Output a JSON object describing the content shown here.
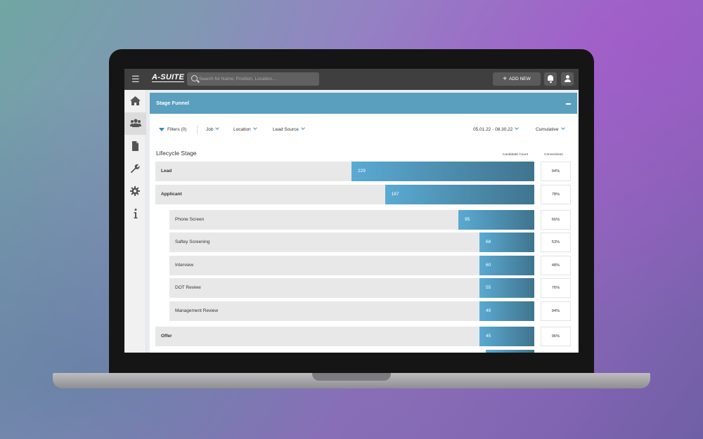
{
  "app": {
    "logo": "A-SUITE",
    "menu_icon": "hamburger-icon",
    "search_placeholder": "Search for Name, Position, Location....",
    "add_new_label": "ADD NEW",
    "icons": [
      "bell-icon",
      "user-icon"
    ]
  },
  "sidebar": {
    "items": [
      {
        "name": "home",
        "icon": "home-icon",
        "active": false
      },
      {
        "name": "candidates",
        "icon": "users-icon",
        "active": true
      },
      {
        "name": "documents",
        "icon": "document-icon",
        "active": false
      },
      {
        "name": "tools",
        "icon": "wrench-icon",
        "active": false
      },
      {
        "name": "settings",
        "icon": "gear-icon",
        "active": false
      },
      {
        "name": "info",
        "icon": "info-icon",
        "active": false
      }
    ]
  },
  "card": {
    "title": "Stage Funnel",
    "collapse_icon": "minus-icon"
  },
  "filters": {
    "filters_label": "Filters (0)",
    "job_label": "Job",
    "location_label": "Location",
    "lead_source_label": "Lead Source",
    "date_range": "05.01.22 - 08.30.22",
    "mode": "Cumulative"
  },
  "funnel": {
    "section_title": "Lifecycle Stage",
    "col_count_label": "Candidate Count",
    "col_conv_label": "Conversions",
    "max_count": 229,
    "stages": [
      {
        "label": "Lead",
        "count": 229,
        "count_text": "229",
        "conversion": "94%",
        "level": 0
      },
      {
        "label": "Applicant",
        "count": 187,
        "count_text": "187",
        "conversion": "78%",
        "level": 0
      },
      {
        "label": "Phone Screen",
        "count": 95,
        "count_text": "95",
        "conversion": "66%",
        "level": 1
      },
      {
        "label": "Saftey Screening",
        "count": 68,
        "count_text": "68",
        "conversion": "53%",
        "level": 1
      },
      {
        "label": "Interview",
        "count": 60,
        "count_text": "60",
        "conversion": "48%",
        "level": 1
      },
      {
        "label": "DOT Review",
        "count": 55,
        "count_text": "55",
        "conversion": "76%",
        "level": 1
      },
      {
        "label": "Management Review",
        "count": 49,
        "count_text": "49",
        "conversion": "94%",
        "level": 1
      },
      {
        "label": "Offer",
        "count": 45,
        "count_text": "45",
        "conversion": "96%",
        "level": 0
      }
    ]
  },
  "colors": {
    "accent": "#5b9fbe",
    "bar_start": "#5aaad3",
    "bar_end": "#3f748f",
    "topbar": "#3f3f3f"
  }
}
